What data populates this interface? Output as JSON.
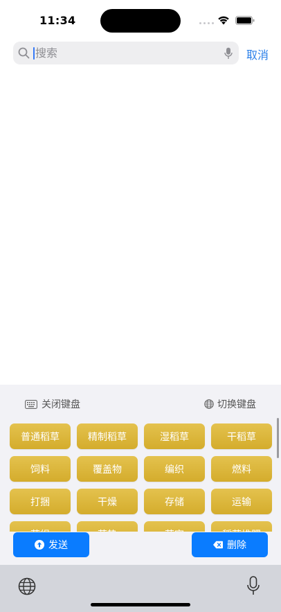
{
  "status": {
    "time": "11:34"
  },
  "search": {
    "placeholder": "搜索",
    "value": "",
    "cancel_label": "取消"
  },
  "panel": {
    "close_keyboard_label": "关闭键盘",
    "switch_keyboard_label": "切换键盘",
    "chips": [
      "普通稻草",
      "精制稻草",
      "湿稻草",
      "干稻草",
      "饲料",
      "覆盖物",
      "编织",
      "燃料",
      "打捆",
      "干燥",
      "存储",
      "运输",
      "草绳",
      "草垫",
      "草帘",
      "稻草堆肥"
    ],
    "send_label": "发送",
    "delete_label": "删除"
  },
  "colors": {
    "accent": "#0a7cff",
    "chip": "#d9b43a",
    "link": "#2a7fe9"
  }
}
